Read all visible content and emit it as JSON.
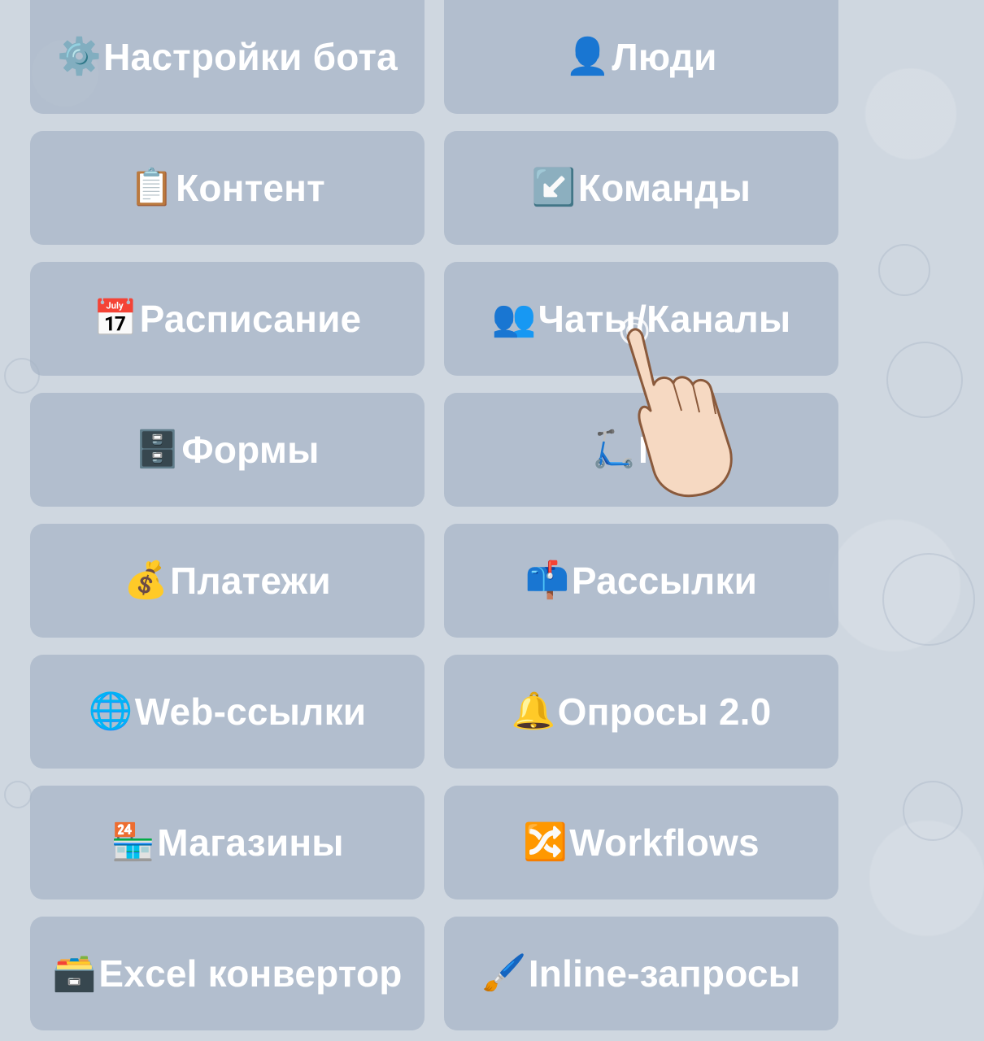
{
  "menu": {
    "buttons": [
      {
        "icon": "⚙️",
        "icon_name": "gear-icon",
        "label": "Настройки бота"
      },
      {
        "icon": "👤",
        "icon_name": "person-icon",
        "label": "Люди"
      },
      {
        "icon": "📋",
        "icon_name": "clipboard-icon",
        "label": "Контент"
      },
      {
        "icon": "↙️",
        "icon_name": "arrow-down-left-icon",
        "label": "Команды"
      },
      {
        "icon": "📅",
        "icon_name": "calendar-icon",
        "label": "Расписание"
      },
      {
        "icon": "👥",
        "icon_name": "people-icon",
        "label": "Чаты/Каналы"
      },
      {
        "icon": "🗄️",
        "icon_name": "file-cabinet-icon",
        "label": "Формы"
      },
      {
        "icon": "🛴",
        "icon_name": "scooter-icon",
        "label": "Ме"
      },
      {
        "icon": "💰",
        "icon_name": "money-bag-icon",
        "label": "Платежи"
      },
      {
        "icon": "📫",
        "icon_name": "mailbox-icon",
        "label": "Рассылки"
      },
      {
        "icon": "🌐",
        "icon_name": "globe-icon",
        "label": "Web-ссылки"
      },
      {
        "icon": "🔔",
        "icon_name": "bell-icon",
        "label": "Опросы 2.0"
      },
      {
        "icon": "🏪",
        "icon_name": "store-icon",
        "label": "Магазины"
      },
      {
        "icon": "🔀",
        "icon_name": "shuffle-icon",
        "label": "Workflows"
      },
      {
        "icon": "🗃️",
        "icon_name": "card-file-box-icon",
        "label": "Excel конвертор"
      },
      {
        "icon": "🖌️",
        "icon_name": "paintbrush-icon",
        "label": "Inline-запросы"
      }
    ]
  },
  "colors": {
    "background": "#cfd7e0",
    "button": "#a6b4c6",
    "text": "#ffffff"
  }
}
